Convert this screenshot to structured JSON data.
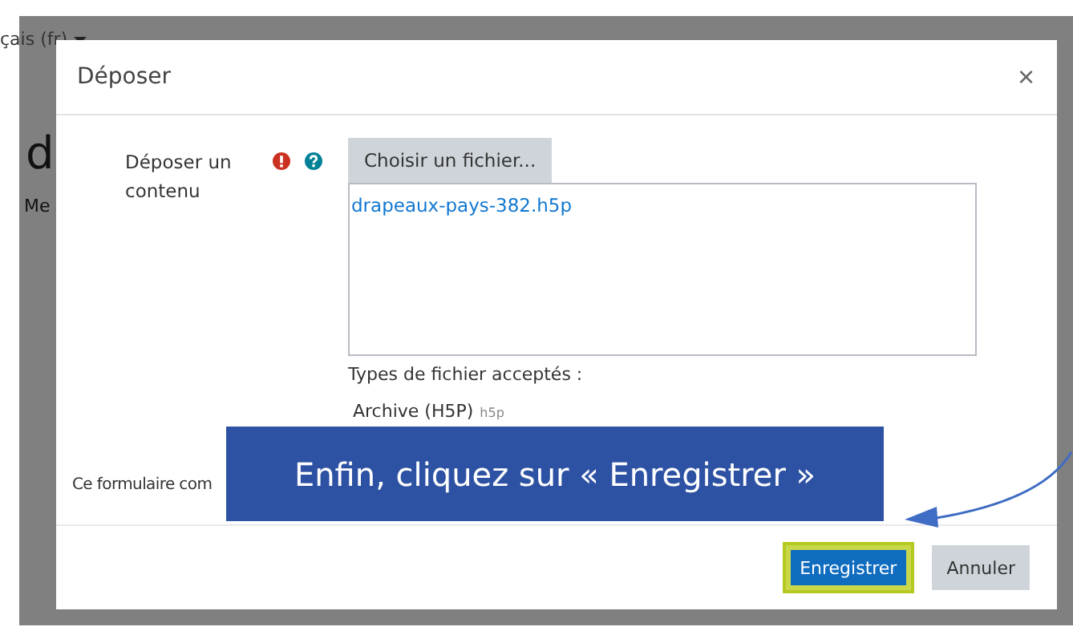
{
  "background": {
    "language": "çais (fr)",
    "heading": "d",
    "subtext": "Me"
  },
  "dialog": {
    "title": "Déposer",
    "close": "×",
    "field_label": "Déposer un contenu",
    "choose_button": "Choisir un fichier...",
    "file": "drapeaux-pays-382.h5p",
    "accepted_label": "Types de fichier acceptés :",
    "accepted_types": [
      {
        "name": "Archive (H5P)",
        "ext": "h5p"
      }
    ],
    "note": "Ce formulaire com",
    "buttons": [
      {
        "label": "Enregistrer",
        "kind": "primary",
        "highlighted": true
      },
      {
        "label": "Annuler",
        "kind": "secondary",
        "highlighted": false
      }
    ]
  },
  "callout": {
    "text": "Enfin, cliquez sur « Enregistrer »"
  }
}
